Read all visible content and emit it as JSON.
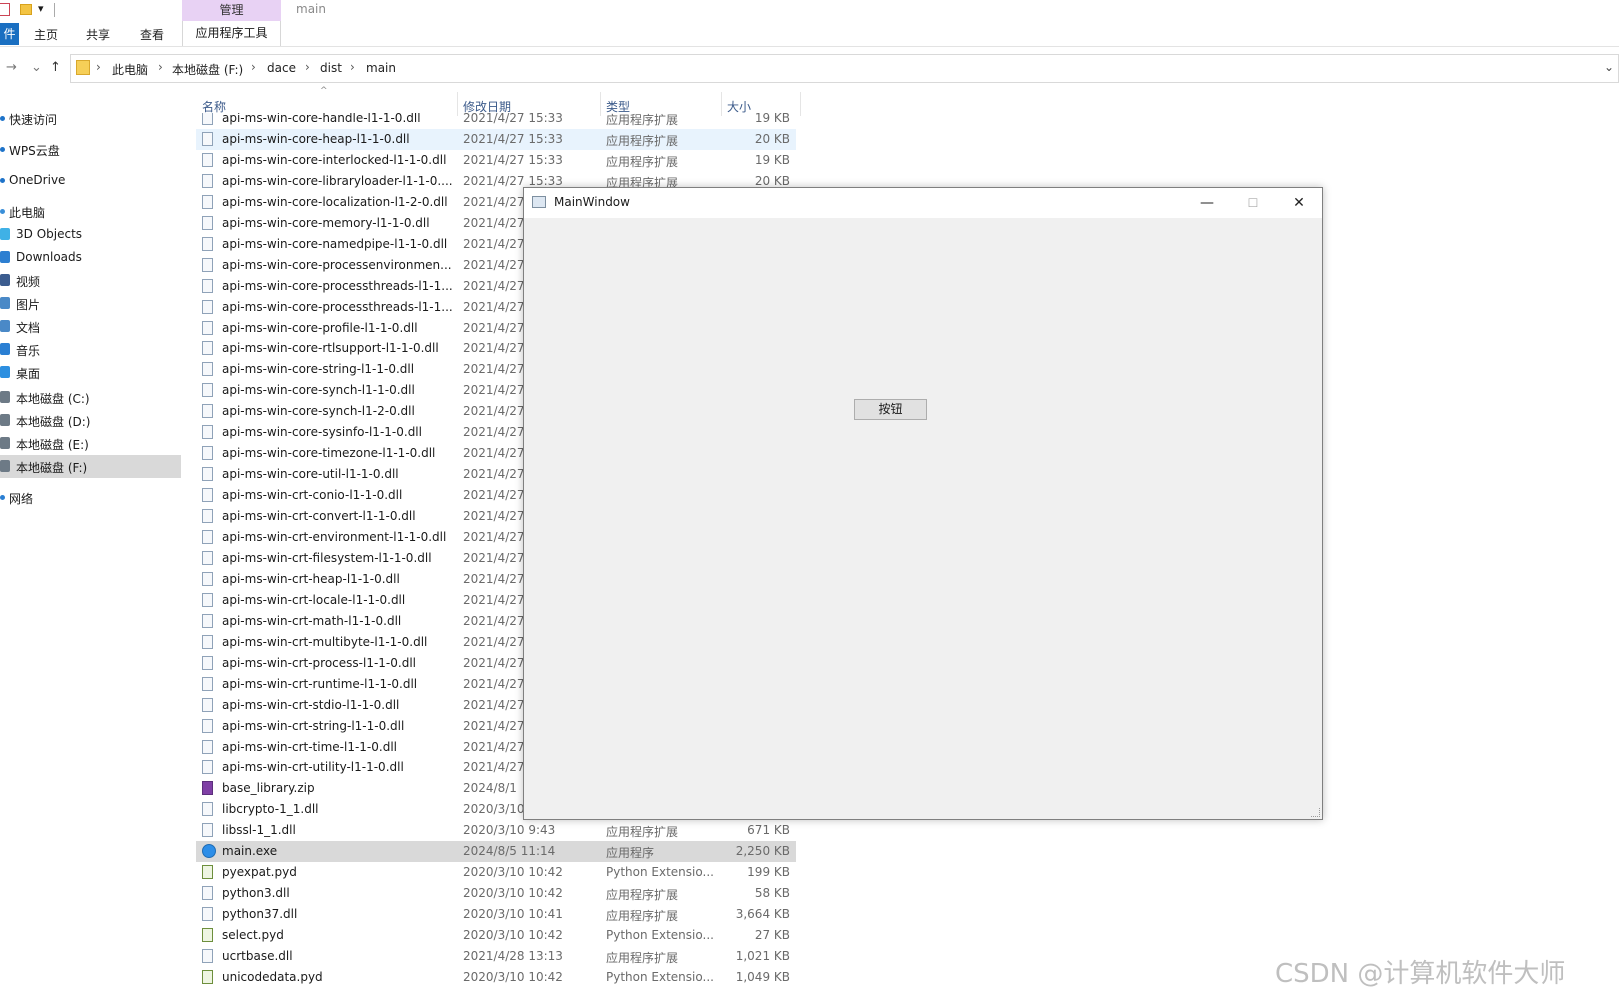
{
  "ribbon": {
    "qat_dropdown": "▾",
    "manage_label": "管理",
    "window_title": "main",
    "file_tab": "件",
    "tabs": [
      "主页",
      "共享",
      "查看"
    ],
    "app_tools_tab": "应用程序工具"
  },
  "nav": {
    "back": "→",
    "recent": "⌄",
    "up": "↑",
    "breadcrumb": [
      "此电脑",
      "本地磁盘 (F:)",
      "dace",
      "dist",
      "main"
    ],
    "separator": "›",
    "dropdown": "⌄"
  },
  "sidebar": {
    "items": [
      {
        "label": "快速访问",
        "icon": "star-icon",
        "color": "#1e73c9"
      },
      {
        "label": "WPS云盘",
        "icon": "cloud-icon",
        "color": "#1e73c9"
      },
      {
        "label": "OneDrive",
        "icon": "onedrive-icon",
        "color": "#1e73c9"
      },
      {
        "label": "此电脑",
        "icon": "computer-icon",
        "color": "#3a8fd9"
      },
      {
        "label": "3D Objects",
        "icon": "cube-icon",
        "color": "#3fb1e6"
      },
      {
        "label": "Downloads",
        "icon": "download-icon",
        "color": "#2d7fd1"
      },
      {
        "label": "视频",
        "icon": "video-icon",
        "color": "#3b5c8f"
      },
      {
        "label": "图片",
        "icon": "pictures-icon",
        "color": "#4a89c7"
      },
      {
        "label": "文档",
        "icon": "documents-icon",
        "color": "#4a89c7"
      },
      {
        "label": "音乐",
        "icon": "music-icon",
        "color": "#2a7fd3"
      },
      {
        "label": "桌面",
        "icon": "desktop-icon",
        "color": "#2d8fe0"
      },
      {
        "label": "本地磁盘 (C:)",
        "icon": "drive-icon",
        "color": "#6d7a86"
      },
      {
        "label": "本地磁盘 (D:)",
        "icon": "drive-icon",
        "color": "#6d7a86"
      },
      {
        "label": "本地磁盘 (E:)",
        "icon": "drive-icon",
        "color": "#6d7a86"
      },
      {
        "label": "本地磁盘 (F:)",
        "icon": "drive-icon",
        "color": "#6d7a86",
        "selected": true
      },
      {
        "label": "网络",
        "icon": "network-icon",
        "color": "#2a7fd3"
      }
    ]
  },
  "columns": {
    "name": "名称",
    "date": "修改日期",
    "type": "类型",
    "size": "大小",
    "sort_caret": "^"
  },
  "files": [
    {
      "name": "api-ms-win-core-handle-l1-1-0.dll",
      "date": "2021/4/27 15:33",
      "type": "应用程序扩展",
      "size": "19 KB",
      "kind": "dll"
    },
    {
      "name": "api-ms-win-core-heap-l1-1-0.dll",
      "date": "2021/4/27 15:33",
      "type": "应用程序扩展",
      "size": "20 KB",
      "kind": "dll",
      "hover": true
    },
    {
      "name": "api-ms-win-core-interlocked-l1-1-0.dll",
      "date": "2021/4/27 15:33",
      "type": "应用程序扩展",
      "size": "19 KB",
      "kind": "dll"
    },
    {
      "name": "api-ms-win-core-libraryloader-l1-1-0....",
      "date": "2021/4/27 15:33",
      "type": "应用程序扩展",
      "size": "20 KB",
      "kind": "dll"
    },
    {
      "name": "api-ms-win-core-localization-l1-2-0.dll",
      "date": "2021/4/27",
      "type": "",
      "size": "",
      "kind": "dll"
    },
    {
      "name": "api-ms-win-core-memory-l1-1-0.dll",
      "date": "2021/4/27",
      "type": "",
      "size": "",
      "kind": "dll"
    },
    {
      "name": "api-ms-win-core-namedpipe-l1-1-0.dll",
      "date": "2021/4/27",
      "type": "",
      "size": "",
      "kind": "dll"
    },
    {
      "name": "api-ms-win-core-processenvironmen...",
      "date": "2021/4/27",
      "type": "",
      "size": "",
      "kind": "dll"
    },
    {
      "name": "api-ms-win-core-processthreads-l1-1...",
      "date": "2021/4/27",
      "type": "",
      "size": "",
      "kind": "dll"
    },
    {
      "name": "api-ms-win-core-processthreads-l1-1...",
      "date": "2021/4/27",
      "type": "",
      "size": "",
      "kind": "dll"
    },
    {
      "name": "api-ms-win-core-profile-l1-1-0.dll",
      "date": "2021/4/27",
      "type": "",
      "size": "",
      "kind": "dll"
    },
    {
      "name": "api-ms-win-core-rtlsupport-l1-1-0.dll",
      "date": "2021/4/27",
      "type": "",
      "size": "",
      "kind": "dll"
    },
    {
      "name": "api-ms-win-core-string-l1-1-0.dll",
      "date": "2021/4/27",
      "type": "",
      "size": "",
      "kind": "dll"
    },
    {
      "name": "api-ms-win-core-synch-l1-1-0.dll",
      "date": "2021/4/27",
      "type": "",
      "size": "",
      "kind": "dll"
    },
    {
      "name": "api-ms-win-core-synch-l1-2-0.dll",
      "date": "2021/4/27",
      "type": "",
      "size": "",
      "kind": "dll"
    },
    {
      "name": "api-ms-win-core-sysinfo-l1-1-0.dll",
      "date": "2021/4/27",
      "type": "",
      "size": "",
      "kind": "dll"
    },
    {
      "name": "api-ms-win-core-timezone-l1-1-0.dll",
      "date": "2021/4/27",
      "type": "",
      "size": "",
      "kind": "dll"
    },
    {
      "name": "api-ms-win-core-util-l1-1-0.dll",
      "date": "2021/4/27",
      "type": "",
      "size": "",
      "kind": "dll"
    },
    {
      "name": "api-ms-win-crt-conio-l1-1-0.dll",
      "date": "2021/4/27",
      "type": "",
      "size": "",
      "kind": "dll"
    },
    {
      "name": "api-ms-win-crt-convert-l1-1-0.dll",
      "date": "2021/4/27",
      "type": "",
      "size": "",
      "kind": "dll"
    },
    {
      "name": "api-ms-win-crt-environment-l1-1-0.dll",
      "date": "2021/4/27",
      "type": "",
      "size": "",
      "kind": "dll"
    },
    {
      "name": "api-ms-win-crt-filesystem-l1-1-0.dll",
      "date": "2021/4/27",
      "type": "",
      "size": "",
      "kind": "dll"
    },
    {
      "name": "api-ms-win-crt-heap-l1-1-0.dll",
      "date": "2021/4/27",
      "type": "",
      "size": "",
      "kind": "dll"
    },
    {
      "name": "api-ms-win-crt-locale-l1-1-0.dll",
      "date": "2021/4/27",
      "type": "",
      "size": "",
      "kind": "dll"
    },
    {
      "name": "api-ms-win-crt-math-l1-1-0.dll",
      "date": "2021/4/27",
      "type": "",
      "size": "",
      "kind": "dll"
    },
    {
      "name": "api-ms-win-crt-multibyte-l1-1-0.dll",
      "date": "2021/4/27",
      "type": "",
      "size": "",
      "kind": "dll"
    },
    {
      "name": "api-ms-win-crt-process-l1-1-0.dll",
      "date": "2021/4/27",
      "type": "",
      "size": "",
      "kind": "dll"
    },
    {
      "name": "api-ms-win-crt-runtime-l1-1-0.dll",
      "date": "2021/4/27",
      "type": "",
      "size": "",
      "kind": "dll"
    },
    {
      "name": "api-ms-win-crt-stdio-l1-1-0.dll",
      "date": "2021/4/27",
      "type": "",
      "size": "",
      "kind": "dll"
    },
    {
      "name": "api-ms-win-crt-string-l1-1-0.dll",
      "date": "2021/4/27",
      "type": "",
      "size": "",
      "kind": "dll"
    },
    {
      "name": "api-ms-win-crt-time-l1-1-0.dll",
      "date": "2021/4/27",
      "type": "",
      "size": "",
      "kind": "dll"
    },
    {
      "name": "api-ms-win-crt-utility-l1-1-0.dll",
      "date": "2021/4/27",
      "type": "",
      "size": "",
      "kind": "dll"
    },
    {
      "name": "base_library.zip",
      "date": "2024/8/1",
      "type": "",
      "size": "",
      "kind": "zip"
    },
    {
      "name": "libcrypto-1_1.dll",
      "date": "2020/3/10",
      "type": "",
      "size": "",
      "kind": "dll"
    },
    {
      "name": "libssl-1_1.dll",
      "date": "2020/3/10 9:43",
      "type": "应用程序扩展",
      "size": "671 KB",
      "kind": "dll"
    },
    {
      "name": "main.exe",
      "date": "2024/8/5 11:14",
      "type": "应用程序",
      "size": "2,250 KB",
      "kind": "exe",
      "selected": true
    },
    {
      "name": "pyexpat.pyd",
      "date": "2020/3/10 10:42",
      "type": "Python Extensio...",
      "size": "199 KB",
      "kind": "py"
    },
    {
      "name": "python3.dll",
      "date": "2020/3/10 10:42",
      "type": "应用程序扩展",
      "size": "58 KB",
      "kind": "dll"
    },
    {
      "name": "python37.dll",
      "date": "2020/3/10 10:41",
      "type": "应用程序扩展",
      "size": "3,664 KB",
      "kind": "dll"
    },
    {
      "name": "select.pyd",
      "date": "2020/3/10 10:42",
      "type": "Python Extensio...",
      "size": "27 KB",
      "kind": "py"
    },
    {
      "name": "ucrtbase.dll",
      "date": "2021/4/28 13:13",
      "type": "应用程序扩展",
      "size": "1,021 KB",
      "kind": "dll"
    },
    {
      "name": "unicodedata.pyd",
      "date": "2020/3/10 10:42",
      "type": "Python Extensio...",
      "size": "1,049 KB",
      "kind": "py"
    }
  ],
  "main_window": {
    "title": "MainWindow",
    "minimize": "—",
    "maximize": "☐",
    "close": "✕",
    "button_label": "按钮"
  },
  "watermark": "CSDN @计算机软件大师"
}
